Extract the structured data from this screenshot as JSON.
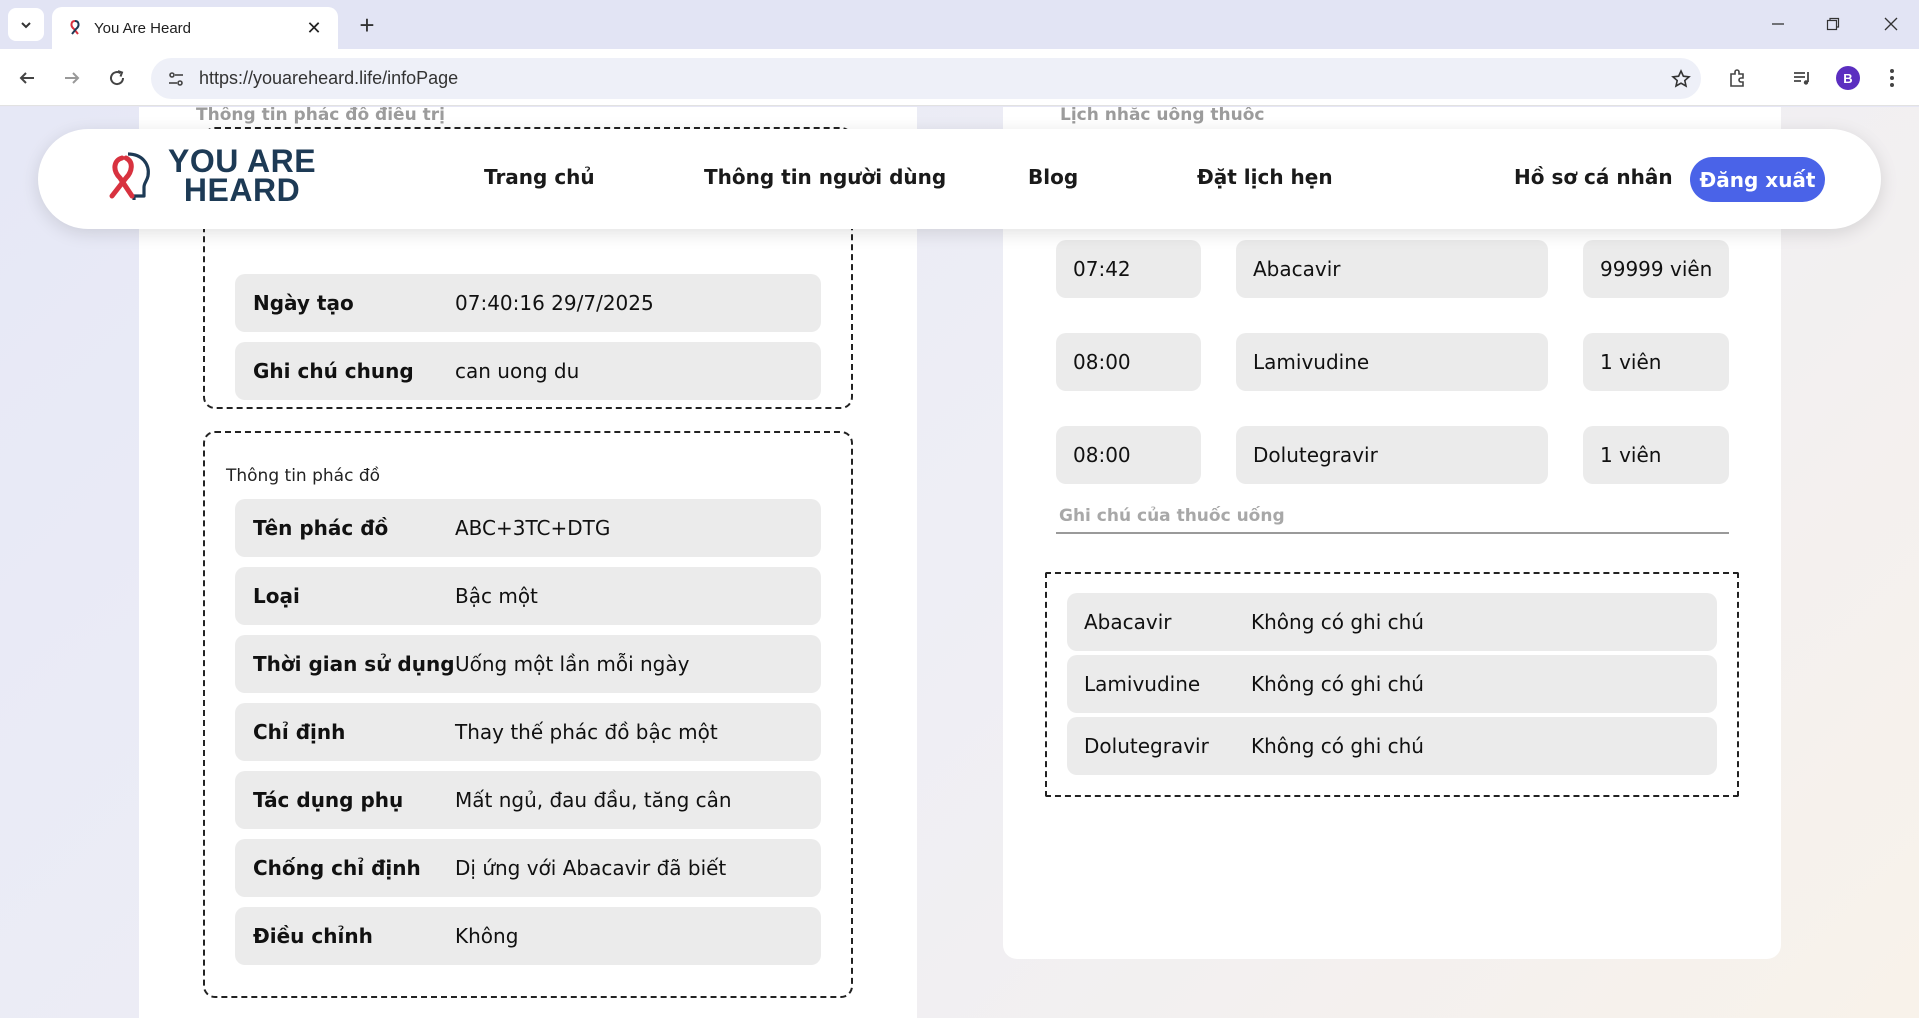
{
  "browser": {
    "tab_title": "You Are Heard",
    "url": "https://youareheard.life/infoPage",
    "profile_initial": "B"
  },
  "nav": {
    "logo_line1": "YOU ARE",
    "logo_line2": "HEARD",
    "links": [
      "Trang chủ",
      "Thông tin người dùng",
      "Blog",
      "Đặt lịch hẹn",
      "Hồ sơ cá nhân"
    ],
    "logout_label": "Đăng xuất"
  },
  "left": {
    "heading": "Thông tin phác đồ điều trị",
    "general": [
      {
        "label": "Ngày tạo",
        "value": "07:40:16 29/7/2025"
      },
      {
        "label": "Ghi chú chung",
        "value": "can uong du"
      }
    ],
    "regimen_caption": "Thông tin phác đồ",
    "regimen": [
      {
        "label": "Tên phác đồ",
        "value": "ABC+3TC+DTG"
      },
      {
        "label": "Loại",
        "value": "Bậc một"
      },
      {
        "label": "Thời gian sử dụng",
        "value": "Uống một lần mỗi ngày"
      },
      {
        "label": "Chỉ định",
        "value": "Thay thế phác đồ bậc một"
      },
      {
        "label": "Tác dụng phụ",
        "value": "Mất ngủ, đau đầu, tăng cân"
      },
      {
        "label": "Chống chỉ định",
        "value": "Dị ứng với Abacavir đã biết"
      },
      {
        "label": "Điều chỉnh",
        "value": "Không"
      }
    ]
  },
  "right": {
    "heading": "Lịch nhắc uống thuốc",
    "reminders": [
      {
        "time": "07:42",
        "drug": "Abacavir",
        "dose": "99999 viên"
      },
      {
        "time": "08:00",
        "drug": "Lamivudine",
        "dose": "1 viên"
      },
      {
        "time": "08:00",
        "drug": "Dolutegravir",
        "dose": "1 viên"
      }
    ],
    "notes_label": "Ghi chú của thuốc uống",
    "notes": [
      {
        "drug": "Abacavir",
        "note": "Không có ghi chú"
      },
      {
        "drug": "Lamivudine",
        "note": "Không có ghi chú"
      },
      {
        "drug": "Dolutegravir",
        "note": "Không có ghi chú"
      }
    ]
  },
  "colors": {
    "accent": "#4a63e8",
    "logo_red": "#d8323f",
    "logo_navy": "#1d3a55",
    "row_bg": "#ebebeb"
  }
}
